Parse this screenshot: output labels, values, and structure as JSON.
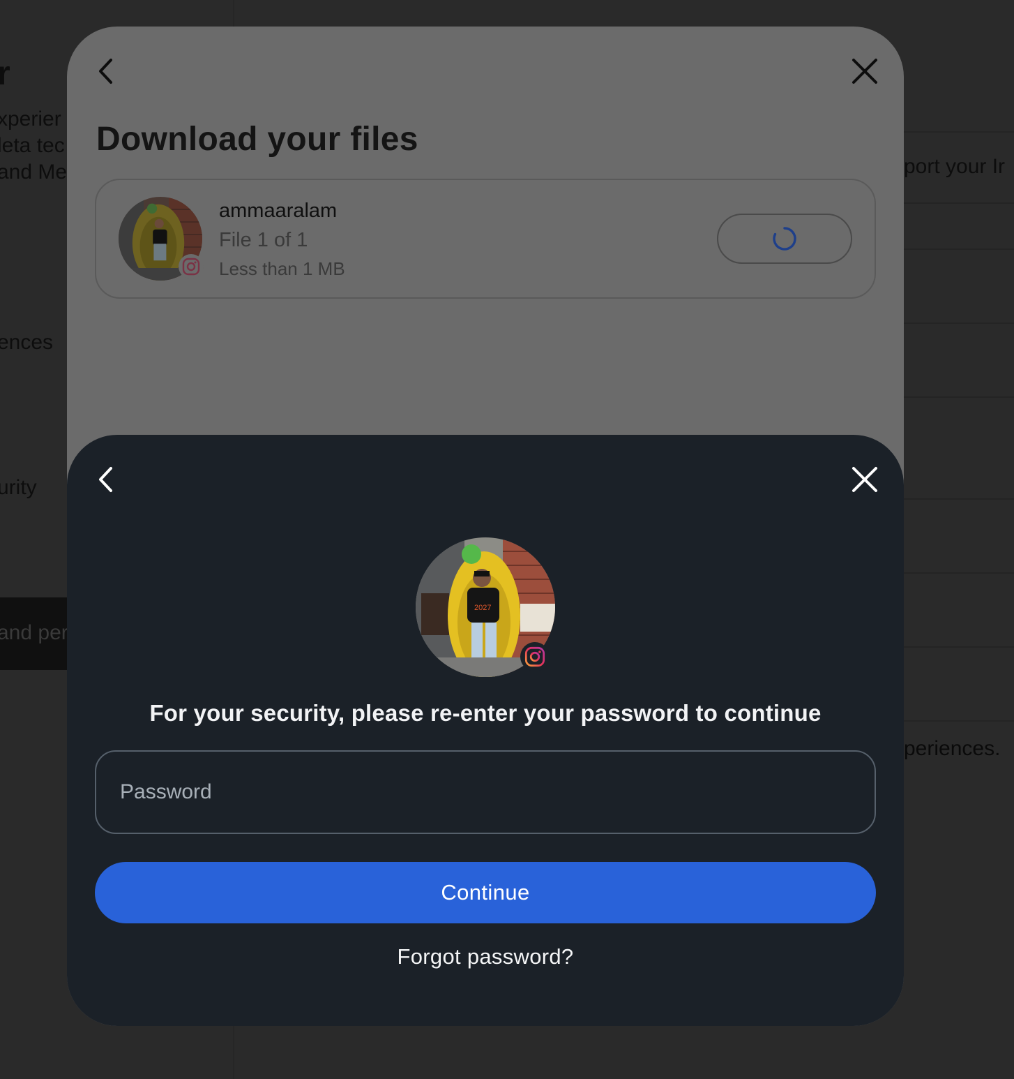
{
  "background": {
    "title_fragment": "r",
    "desc_lines": [
      "xperier",
      "leta tec",
      "and Me"
    ],
    "nav_preferences": "ences",
    "nav_security": "urity",
    "nav_active": "and per",
    "right_text_top": "port your Ir",
    "right_text_bottom": "periences."
  },
  "download_modal": {
    "back_icon": "chevron-left-icon",
    "close_icon": "close-icon",
    "title": "Download your files",
    "file": {
      "username": "ammaaralam",
      "count": "File 1 of 1",
      "size": "Less than 1 MB",
      "platform_icon": "instagram-icon",
      "status_icon": "loading-spinner-icon"
    }
  },
  "password_modal": {
    "back_icon": "chevron-left-icon",
    "close_icon": "close-icon",
    "platform_icon": "instagram-icon",
    "prompt": "For your security, please re-enter your password to continue",
    "password_placeholder": "Password",
    "password_value": "",
    "continue_label": "Continue",
    "forgot_label": "Forgot password?"
  },
  "colors": {
    "accent": "#2962d9",
    "modal_dark": "#1b2128",
    "spinner": "#2a5bd7"
  }
}
